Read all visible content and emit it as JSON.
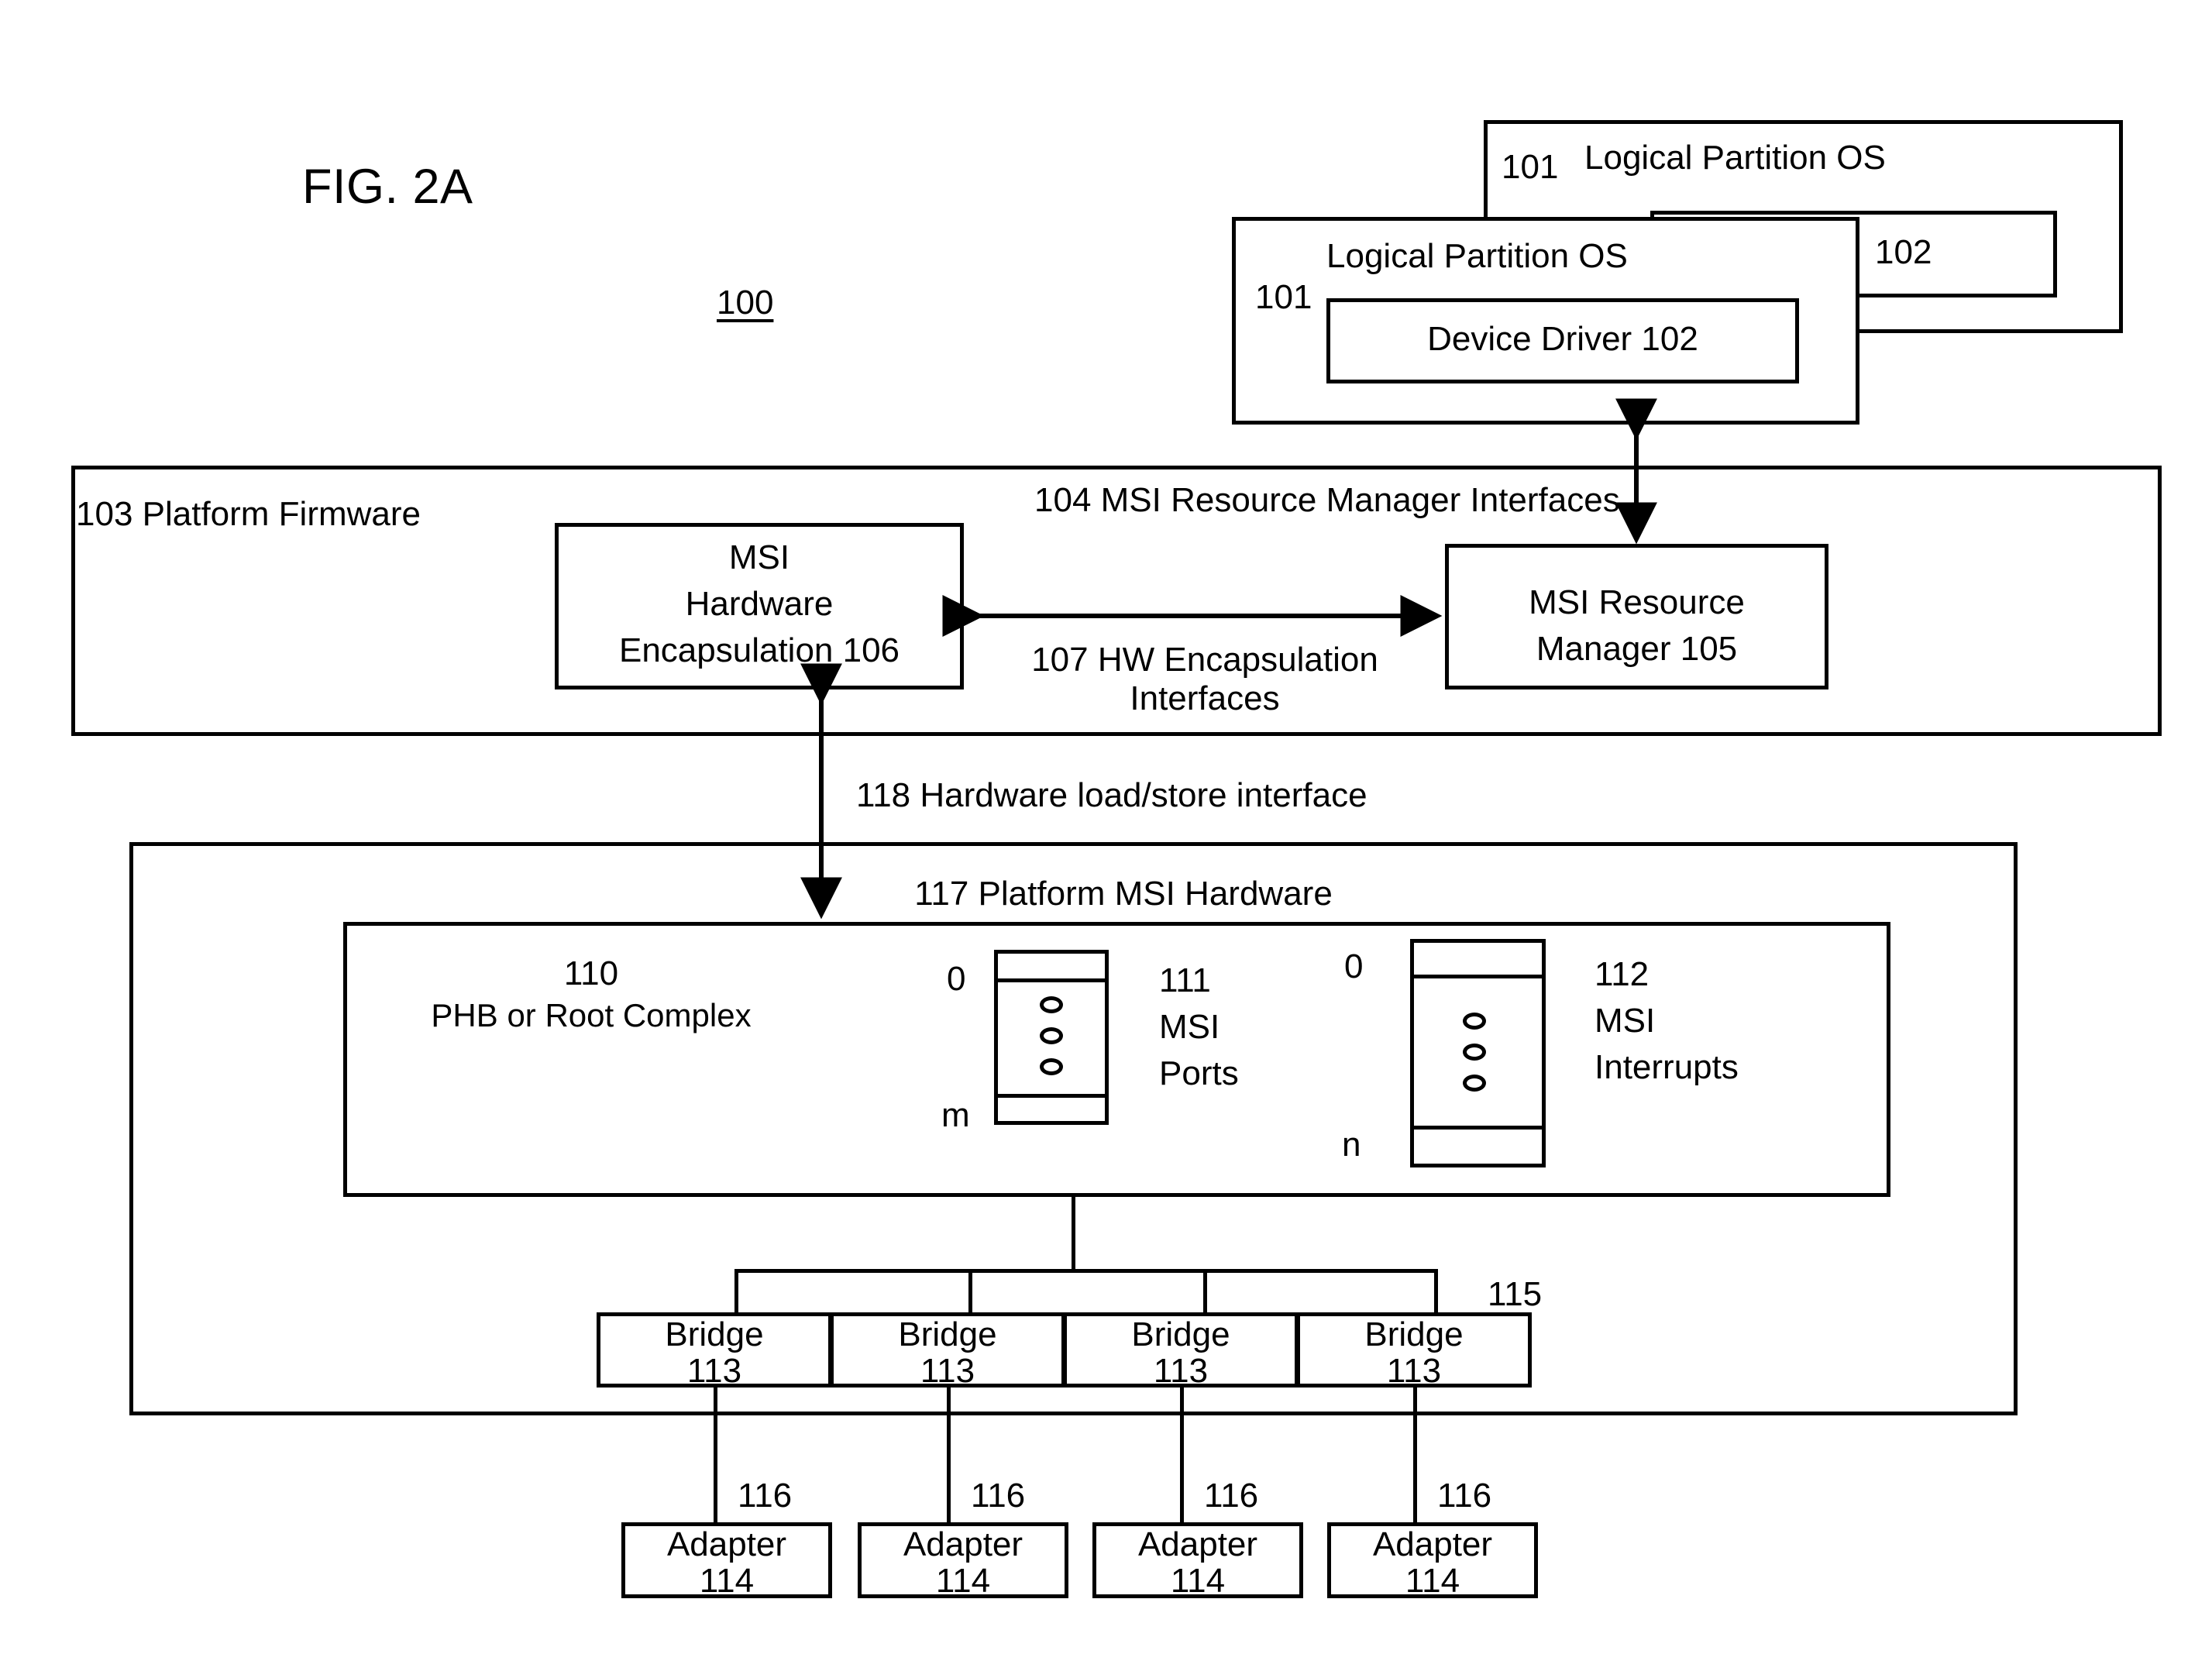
{
  "figure": {
    "title": "FIG. 2A",
    "system_ref": "100"
  },
  "partitions": {
    "back": {
      "ref": "101",
      "title": "Logical Partition OS",
      "driver_ref": "102"
    },
    "front": {
      "ref": "101",
      "title": "Logical Partition OS",
      "driver_label": "Device Driver 102"
    }
  },
  "firmware": {
    "label": "103 Platform Firmware",
    "encapsulation": {
      "line1": "MSI",
      "line2": "Hardware",
      "line3": "Encapsulation 106"
    },
    "resource_manager": {
      "line1": "MSI Resource",
      "line2": "Manager 105"
    },
    "rm_interfaces_label": "104 MSI Resource Manager Interfaces",
    "hw_encapsulation_interfaces": {
      "line1": "107 HW Encapsulation",
      "line2": "Interfaces"
    }
  },
  "load_store": {
    "label": "118 Hardware load/store interface"
  },
  "hardware": {
    "label": "117 Platform MSI Hardware",
    "phb": {
      "ref": "110",
      "label": "PHB or Root Complex"
    },
    "msi_ports": {
      "ref": "111",
      "line1": "MSI",
      "line2": "Ports",
      "index_first": "0",
      "index_last": "m"
    },
    "msi_interrupts": {
      "ref": "112",
      "line1": "MSI",
      "line2": "Interrupts",
      "index_first": "0",
      "index_last": "n"
    },
    "bus_ref": "115",
    "bridges": [
      {
        "name": "Bridge",
        "ref": "113"
      },
      {
        "name": "Bridge",
        "ref": "113"
      },
      {
        "name": "Bridge",
        "ref": "113"
      },
      {
        "name": "Bridge",
        "ref": "113"
      }
    ],
    "link_refs": [
      "116",
      "116",
      "116",
      "116"
    ],
    "adapters": [
      {
        "name": "Adapter",
        "ref": "114"
      },
      {
        "name": "Adapter",
        "ref": "114"
      },
      {
        "name": "Adapter",
        "ref": "114"
      },
      {
        "name": "Adapter",
        "ref": "114"
      }
    ]
  }
}
